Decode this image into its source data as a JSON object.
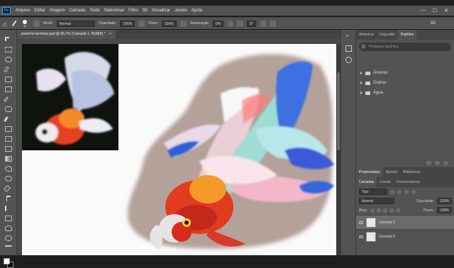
{
  "menubar": {
    "items": [
      "Arquivo",
      "Editar",
      "Imagem",
      "Camada",
      "Texto",
      "Selecionar",
      "Filtro",
      "3D",
      "Visualizar",
      "Janela",
      "Ajuda"
    ],
    "logo": "Ps",
    "minimize": "—",
    "maximize": "☐",
    "close": "✕"
  },
  "optionsbar": {
    "brush_size": "30",
    "mode_label": "Modo:",
    "mode_value": "Normal",
    "opacity_label": "Opacidade:",
    "opacity_value": "100%",
    "flow_label": "Fluxo:",
    "flow_value": "100%",
    "smoothing_label": "Suavização:",
    "smoothing_value": "0%",
    "angle_value": "0°",
    "mode3d": "3D"
  },
  "document": {
    "tab_title": "peixinho terminar.psd @ 66,7% (Camada 1, RGB/8) *",
    "tab_close": "×"
  },
  "panels": {
    "top_tabs": [
      "Amostras",
      "Degradês",
      "Padrões"
    ],
    "search_placeholder": "Pesquisar padrões",
    "folders": [
      "Árvores",
      "Grama",
      "Água"
    ],
    "mid_tabs": [
      "Propriedades",
      "Ajustes",
      "Bibliotecas"
    ],
    "layer_tabs": [
      "Camadas",
      "Canais",
      "Demarcadores"
    ],
    "kind_label": "Tipo",
    "blend_mode": "Normal",
    "opacity_label": "Opacidade:",
    "opacity_value": "100%",
    "lock_label": "Bloq.:",
    "fill_label": "Preen.:",
    "fill_value": "100%",
    "layers": [
      "Camada 1",
      "Camada 3"
    ]
  },
  "colors": {
    "foreground": "#ffffff",
    "background": "#000000",
    "ui_dark": "#535353",
    "panel_tab_bg": "#454545"
  }
}
